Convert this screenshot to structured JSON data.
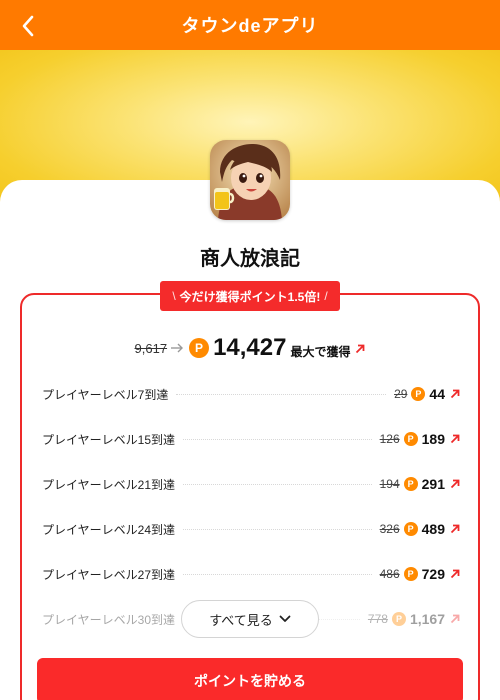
{
  "header": {
    "title": "タウンdeアプリ"
  },
  "app": {
    "name": "商人放浪記"
  },
  "promo": {
    "badge_text": "今だけ獲得ポイント1.5倍!",
    "slash_left": "\\",
    "slash_right": "/"
  },
  "total": {
    "old_points": "9,617",
    "new_points": "14,427",
    "suffix": "最大で獲得"
  },
  "coin_symbol": "P",
  "missions": [
    {
      "label": "プレイヤーレベル7到達",
      "old": "29",
      "new": "44"
    },
    {
      "label": "プレイヤーレベル15到達",
      "old": "126",
      "new": "189"
    },
    {
      "label": "プレイヤーレベル21到達",
      "old": "194",
      "new": "291"
    },
    {
      "label": "プレイヤーレベル24到達",
      "old": "326",
      "new": "489"
    },
    {
      "label": "プレイヤーレベル27到達",
      "old": "486",
      "new": "729"
    },
    {
      "label": "プレイヤーレベル30到達",
      "old": "778",
      "new": "1,167"
    }
  ],
  "see_all_label": "すべて見る",
  "cta_label": "ポイントを貯める",
  "colors": {
    "header": "#ff7a00",
    "accent_red": "#f42b2b",
    "coin": "#ff8a00",
    "hero_yellow": "#f6cf2e"
  },
  "icons": {
    "back": "chevron-left-icon",
    "coin": "point-coin-icon",
    "external": "external-arrow-icon",
    "dropdown": "chevron-down-icon"
  }
}
